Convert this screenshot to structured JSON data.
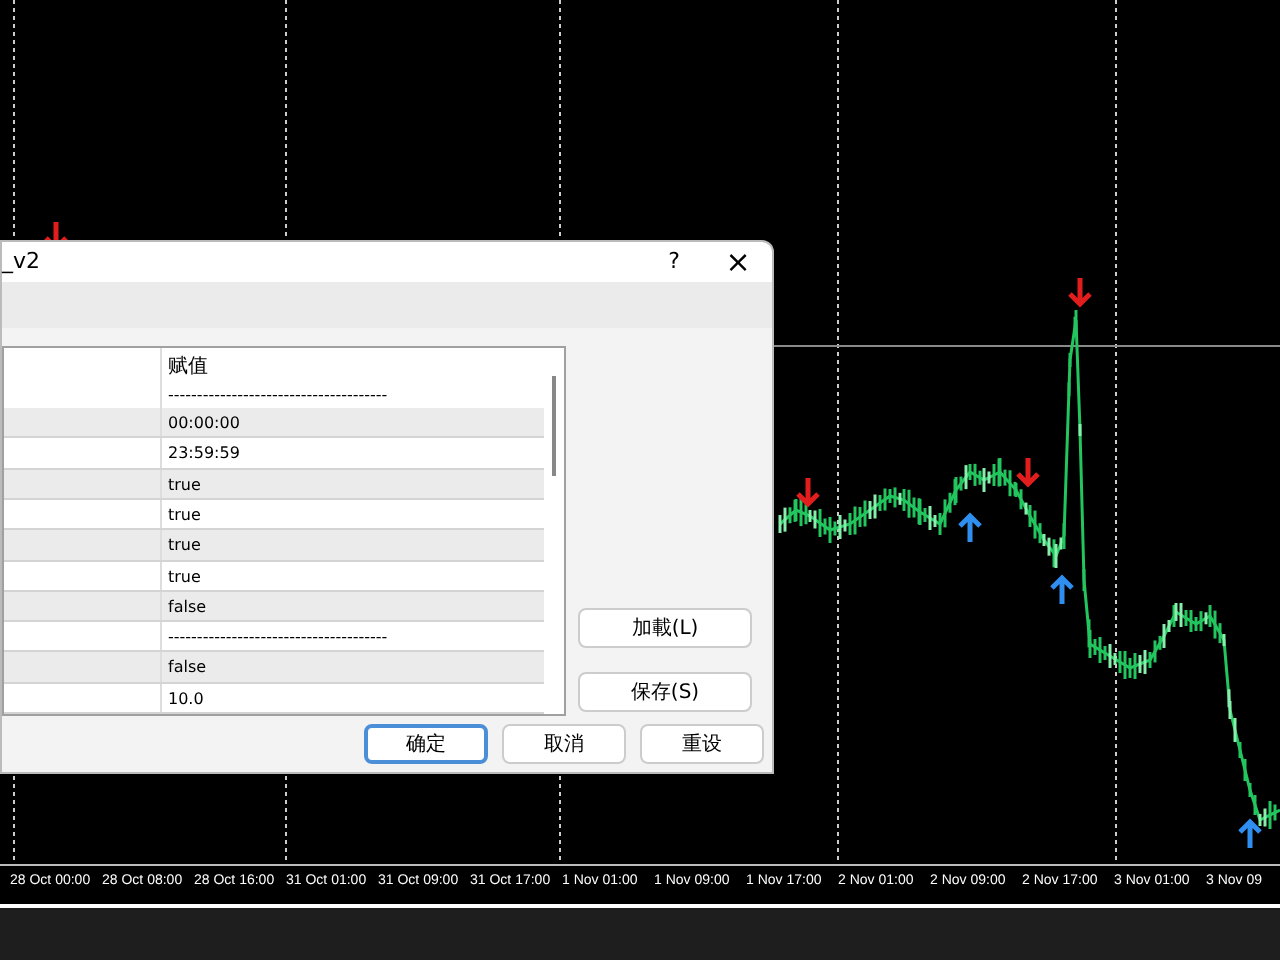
{
  "dialog": {
    "title": "_v2",
    "help_button": "?",
    "close_button": "×",
    "table": {
      "columns": [
        "赋值"
      ],
      "rows": [
        "--------------------------------------",
        "00:00:00",
        "23:59:59",
        "true",
        "true",
        "true",
        "true",
        "false",
        "--------------------------------------",
        "false",
        "10.0"
      ]
    },
    "side_buttons": [
      "加載(L)",
      "保存(S)"
    ],
    "footer_buttons": [
      {
        "label": "确定",
        "default": true
      },
      {
        "label": "取消",
        "default": false
      },
      {
        "label": "重设",
        "default": false
      }
    ]
  },
  "time_axis": [
    "28 Oct 00:00",
    "28 Oct 08:00",
    "28 Oct 16:00",
    "31 Oct 01:00",
    "31 Oct 09:00",
    "31 Oct 17:00",
    "1 Nov 01:00",
    "1 Nov 09:00",
    "1 Nov 17:00",
    "2 Nov 01:00",
    "2 Nov 09:00",
    "2 Nov 17:00",
    "3 Nov 01:00",
    "3 Nov 09"
  ]
}
